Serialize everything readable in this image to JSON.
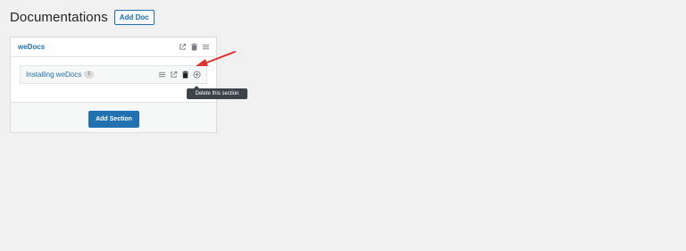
{
  "page": {
    "title": "Documentations",
    "add_doc_label": "Add Doc"
  },
  "doc": {
    "title": "weDocs",
    "header_icons": [
      "external-link-icon",
      "trash-icon",
      "menu-icon"
    ],
    "section": {
      "title": "Installing weDocs",
      "article_count": "1",
      "icons": [
        "menu-icon",
        "external-link-icon",
        "trash-icon",
        "plus-circle-icon"
      ]
    },
    "add_section_label": "Add Section"
  },
  "tooltip": {
    "text": "Delete this section"
  },
  "colors": {
    "accent": "#2271b1",
    "background": "#f0f0f1",
    "arrow": "#e0322c",
    "tooltip_bg": "#3c434a"
  }
}
